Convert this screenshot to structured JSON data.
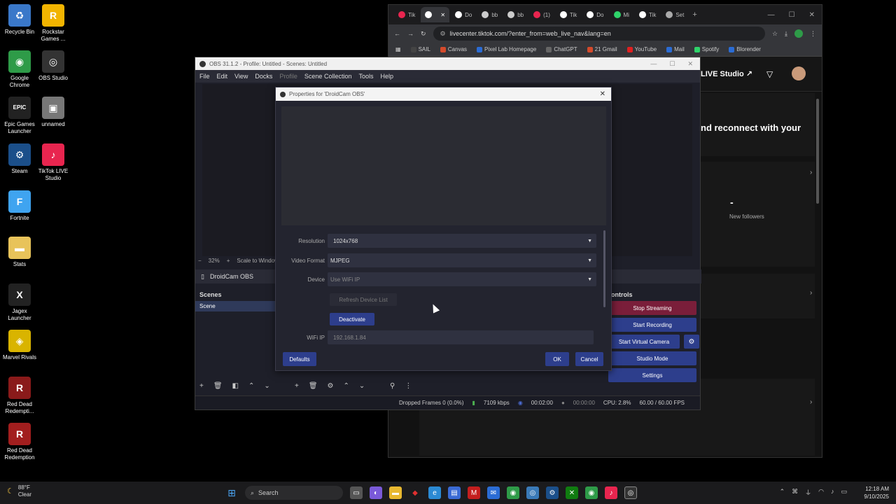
{
  "desktop": {
    "icons": [
      {
        "label": "Recycle Bin",
        "glyph": "♻",
        "color": "#3a78c9"
      },
      {
        "label": "Rockstar Games ...",
        "glyph": "R",
        "color": "#f2b400"
      },
      {
        "label": "Google Chrome",
        "glyph": "◉",
        "color": "#2e9b48"
      },
      {
        "label": "OBS Studio",
        "glyph": "◎",
        "color": "#333333"
      },
      {
        "label": "Epic Games Launcher",
        "glyph": "EPIC",
        "color": "#222222"
      },
      {
        "label": "unnamed",
        "glyph": "▣",
        "color": "#777777"
      },
      {
        "label": "Steam",
        "glyph": "⚙",
        "color": "#1b4f8a"
      },
      {
        "label": "TikTok LIVE Studio",
        "glyph": "♪",
        "color": "#e8254f"
      },
      {
        "label": "Fortnite",
        "glyph": "F",
        "color": "#3fa4f0"
      },
      {
        "label": "Stats",
        "glyph": "▬",
        "color": "#e8c35a"
      },
      {
        "label": "Jagex Launcher",
        "glyph": "X",
        "color": "#222222"
      },
      {
        "label": "Marvel Rivals",
        "glyph": "◈",
        "color": "#d9b400"
      },
      {
        "label": "Red Dead Redempti...",
        "glyph": "R",
        "color": "#8a1a1a"
      },
      {
        "label": "Red Dead Redemption",
        "glyph": "R",
        "color": "#a21e1e"
      }
    ]
  },
  "browser": {
    "tabs": [
      {
        "label": "Tik",
        "color": "#e8254f",
        "active": false
      },
      {
        "label": "",
        "color": "#ffffff",
        "active": true
      },
      {
        "label": "Do",
        "color": "#ffffff",
        "active": false
      },
      {
        "label": "bb",
        "color": "#cccccc",
        "active": false
      },
      {
        "label": "bb",
        "color": "#cccccc",
        "active": false
      },
      {
        "label": "(1)",
        "color": "#e8254f",
        "active": false
      },
      {
        "label": "Tik",
        "color": "#ffffff",
        "active": false
      },
      {
        "label": "Do",
        "color": "#ffffff",
        "active": false
      },
      {
        "label": "Mi",
        "color": "#2fd36a",
        "active": false
      },
      {
        "label": "Tik",
        "color": "#ffffff",
        "active": false
      },
      {
        "label": "Set",
        "color": "#aaaaaa",
        "active": false
      }
    ],
    "url": "livecenter.tiktok.com/?enter_from=web_live_nav&lang=en",
    "bookmarks": [
      {
        "label": "SAIL",
        "color": "#444444"
      },
      {
        "label": "Canvas",
        "color": "#d44a2b"
      },
      {
        "label": "Pixel Lab Homepage",
        "color": "#2b6cd4"
      },
      {
        "label": "ChatGPT",
        "color": "#666666"
      },
      {
        "label": "21 Gmail",
        "color": "#d44a2b"
      },
      {
        "label": "YouTube",
        "color": "#e02020"
      },
      {
        "label": "Mail",
        "color": "#2b6cd4"
      },
      {
        "label": "Spotify",
        "color": "#2fd36a"
      },
      {
        "label": "Blorender",
        "color": "#2b6cd4"
      }
    ],
    "tiktok": {
      "live_studio": "LIVE Studio ↗",
      "reconnect": "nd reconnect with your",
      "dash": "-",
      "new_followers": "New followers"
    }
  },
  "obs": {
    "title": "OBS 31.1.2 - Profile: Untitled - Scenes: Untitled",
    "menu": [
      "File",
      "Edit",
      "View",
      "Docks",
      "Profile",
      "Scene Collection",
      "Tools",
      "Help"
    ],
    "zoom": "32%",
    "scale_label": "Scale to Window",
    "source_name": "DroidCam OBS",
    "scenes_title": "Scenes",
    "scene_item": "Scene",
    "controls_title": "ontrols",
    "controls": {
      "stop_streaming": "Stop Streaming",
      "start_recording": "Start Recording",
      "start_virtual_camera": "Start Virtual Camera",
      "studio_mode": "Studio Mode",
      "settings": "Settings"
    },
    "status": {
      "dropped": "Dropped Frames 0 (0.0%)",
      "bitrate": "7109 kbps",
      "stream_time": "00:02:00",
      "rec_time": "00:00:00",
      "cpu": "CPU: 2.8%",
      "fps": "60.00 / 60.00 FPS"
    }
  },
  "properties": {
    "title": "Properties for 'DroidCam OBS'",
    "resolution_label": "Resolution",
    "resolution_value": "1024x768",
    "video_format_label": "Video Format",
    "video_format_value": "MJPEG",
    "device_label": "Device",
    "device_value": "Use WiFi IP",
    "refresh_label": "Refresh Device List",
    "deactivate_label": "Deactivate",
    "wifi_label": "WiFi IP",
    "wifi_value": "192.168.1.84",
    "defaults_label": "Defaults",
    "ok_label": "OK",
    "cancel_label": "Cancel"
  },
  "taskbar": {
    "weather_temp": "88°F",
    "weather_desc": "Clear",
    "search_placeholder": "Search",
    "time": "12:18 AM",
    "date": "9/10/2025"
  }
}
